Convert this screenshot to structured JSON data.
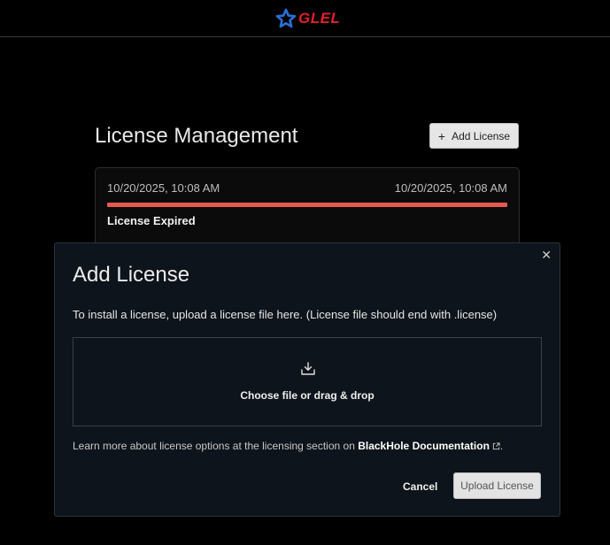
{
  "brand": {
    "name": "GLEL",
    "color": "#e0202a",
    "icon_color": "#2a6fd6"
  },
  "page": {
    "title": "License Management",
    "add_button_label": "Add License",
    "add_button_icon": "plus-icon"
  },
  "license_card": {
    "start_date": "10/20/2025, 10:08 AM",
    "end_date": "10/20/2025, 10:08 AM",
    "status": "License Expired",
    "status_color": "#e55a50"
  },
  "modal": {
    "title": "Add License",
    "close_icon": "close-icon",
    "description": "To install a license, upload a license file here. (License file should end with .license)",
    "dropzone": {
      "icon": "upload-tray-icon",
      "label": "Choose file or drag & drop"
    },
    "learn_more_prefix": "Learn more about license options at the licensing section on ",
    "doc_link_label": "BlackHole Documentation",
    "learn_more_suffix": ".",
    "cancel_label": "Cancel",
    "upload_label": "Upload License"
  }
}
